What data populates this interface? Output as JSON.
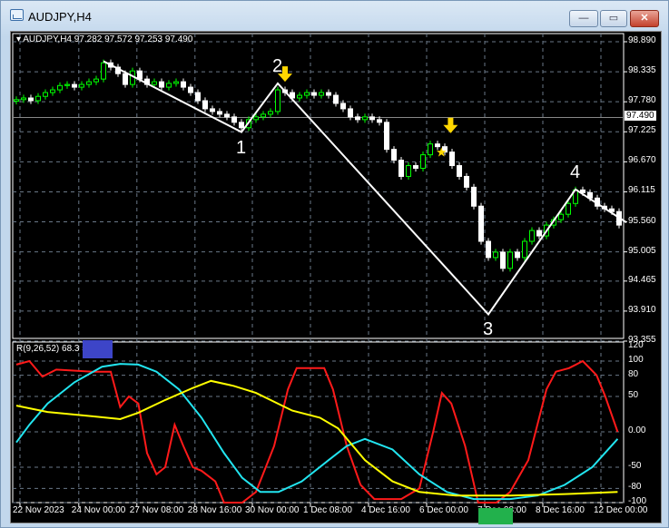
{
  "window": {
    "title": "AUDJPY,H4",
    "min": "—",
    "max": "▭",
    "close": "✕"
  },
  "chart_header": "AUDJPY,H4  97.282 97.572 97.253 97.490",
  "indicator_header": "R(9,26,52) 68.3 5",
  "current_price": "97.490",
  "colors": {
    "bull": "#00ff00",
    "bear": "#ffffff",
    "zigzag": "#ffffff",
    "red": "#ff1a1a",
    "cyan": "#22e5f0",
    "yellow": "#ffff00",
    "arrow": "#ffd700"
  },
  "chart_data": [
    {
      "type": "candlestick",
      "title": "AUDJPY,H4",
      "ylim": [
        93.355,
        98.89
      ],
      "price_ticks": [
        "98.890",
        "98.335",
        "97.780",
        "97.225",
        "96.670",
        "96.115",
        "95.560",
        "95.005",
        "94.465",
        "93.910",
        "93.355"
      ],
      "time_ticks": [
        {
          "t": -0.5,
          "label": "22 Nov 2023"
        },
        {
          "t": 7.6,
          "label": "24 Nov 00:00"
        },
        {
          "t": 15.6,
          "label": "27 Nov 08:00"
        },
        {
          "t": 23.6,
          "label": "28 Nov 16:00"
        },
        {
          "t": 31.5,
          "label": "30 Nov 00:00"
        },
        {
          "t": 39.5,
          "label": "1 Dec 08:00"
        },
        {
          "t": 47.5,
          "label": "4 Dec 16:00"
        },
        {
          "t": 55.5,
          "label": "6 Dec 00:00"
        },
        {
          "t": 63.5,
          "label": "7 Dec 08:00"
        },
        {
          "t": 71.5,
          "label": "8 Dec 16:00"
        },
        {
          "t": 79.5,
          "label": "12 Dec 00:00"
        }
      ],
      "closes": [
        97.82,
        97.85,
        97.8,
        97.88,
        97.95,
        98.0,
        98.08,
        98.1,
        98.05,
        98.1,
        98.15,
        98.2,
        98.5,
        98.42,
        98.3,
        98.1,
        98.35,
        98.2,
        98.1,
        98.15,
        98.05,
        98.12,
        98.15,
        98.05,
        97.95,
        97.8,
        97.65,
        97.6,
        97.55,
        97.5,
        97.4,
        97.3,
        97.45,
        97.5,
        97.55,
        97.6,
        98.0,
        97.95,
        97.85,
        97.9,
        97.95,
        97.9,
        97.95,
        97.9,
        97.75,
        97.65,
        97.5,
        97.45,
        97.5,
        97.45,
        97.4,
        96.9,
        96.7,
        96.4,
        96.6,
        96.55,
        96.8,
        97.0,
        96.95,
        96.85,
        96.6,
        96.4,
        96.2,
        95.85,
        95.2,
        94.9,
        95.0,
        94.7,
        95.0,
        94.9,
        95.2,
        95.4,
        95.3,
        95.5,
        95.6,
        95.7,
        95.9,
        96.15,
        96.1,
        96.0,
        95.85,
        95.8,
        95.75,
        95.5
      ],
      "zigzag": [
        {
          "t": 12,
          "p": 98.53,
          "label": ""
        },
        {
          "t": 31,
          "p": 97.22,
          "label": "1"
        },
        {
          "t": 36,
          "p": 98.12,
          "label": "2"
        },
        {
          "t": 65,
          "p": 93.85,
          "label": "3"
        },
        {
          "t": 77,
          "p": 96.16,
          "label": "4"
        },
        {
          "t": 84,
          "p": 95.55,
          "label": ""
        }
      ],
      "arrows": [
        {
          "t": 37,
          "p": 98.2
        },
        {
          "t": 59.8,
          "p": 97.25
        }
      ],
      "stars": [
        {
          "t": 58.5,
          "p": 96.85
        }
      ]
    },
    {
      "type": "line",
      "title": "R(9,26,52)",
      "ylim": [
        -110,
        125
      ],
      "ticks": [
        "120",
        "100",
        "80",
        "50",
        "0.00",
        "-50",
        "-80",
        "-100"
      ],
      "tick_values": [
        120,
        100,
        80,
        50,
        0,
        -50,
        -80,
        -100
      ],
      "series": [
        {
          "name": "red",
          "points": [
            [
              0,
              95
            ],
            [
              1.8,
              100
            ],
            [
              3.6,
              78
            ],
            [
              5.5,
              88
            ],
            [
              10.5,
              85
            ],
            [
              13,
              85
            ],
            [
              14.3,
              35
            ],
            [
              15.5,
              50
            ],
            [
              16.8,
              40
            ],
            [
              18,
              -30
            ],
            [
              19.3,
              -60
            ],
            [
              20.5,
              -50
            ],
            [
              21.8,
              10
            ],
            [
              23,
              -20
            ],
            [
              24.3,
              -50
            ],
            [
              25.5,
              -55
            ],
            [
              27.4,
              -70
            ],
            [
              28.6,
              -100
            ],
            [
              31.1,
              -100
            ],
            [
              33,
              -85
            ],
            [
              35.5,
              -20
            ],
            [
              37.4,
              60
            ],
            [
              38.6,
              90
            ],
            [
              42.4,
              90
            ],
            [
              43.6,
              60
            ],
            [
              45.5,
              -20
            ],
            [
              47.4,
              -75
            ],
            [
              49.3,
              -95
            ],
            [
              53,
              -95
            ],
            [
              55.5,
              -80
            ],
            [
              57.4,
              0
            ],
            [
              58.6,
              55
            ],
            [
              59.9,
              40
            ],
            [
              61.8,
              -20
            ],
            [
              63.6,
              -100
            ],
            [
              66.1,
              -100
            ],
            [
              68,
              -85
            ],
            [
              70.5,
              -40
            ],
            [
              73,
              60
            ],
            [
              74.3,
              85
            ],
            [
              76.1,
              90
            ],
            [
              78,
              100
            ],
            [
              79.9,
              80
            ],
            [
              81.1,
              50
            ],
            [
              82.8,
              0
            ]
          ]
        },
        {
          "name": "cyan",
          "points": [
            [
              0,
              -15
            ],
            [
              1.8,
              10
            ],
            [
              4.3,
              40
            ],
            [
              8,
              70
            ],
            [
              11.8,
              92
            ],
            [
              14.3,
              96
            ],
            [
              16.8,
              95
            ],
            [
              19.3,
              85
            ],
            [
              22.4,
              60
            ],
            [
              25.5,
              20
            ],
            [
              28.6,
              -30
            ],
            [
              31.1,
              -65
            ],
            [
              33.6,
              -85
            ],
            [
              36.1,
              -85
            ],
            [
              39.3,
              -70
            ],
            [
              43,
              -40
            ],
            [
              45.5,
              -20
            ],
            [
              48,
              -10
            ],
            [
              51.8,
              -25
            ],
            [
              55.5,
              -60
            ],
            [
              59.3,
              -85
            ],
            [
              63,
              -95
            ],
            [
              68,
              -95
            ],
            [
              71.8,
              -90
            ],
            [
              75.5,
              -75
            ],
            [
              79.3,
              -50
            ],
            [
              82.8,
              -10
            ]
          ]
        },
        {
          "name": "yellow",
          "points": [
            [
              0,
              37
            ],
            [
              4.3,
              28
            ],
            [
              10.5,
              22
            ],
            [
              14.3,
              18
            ],
            [
              16.8,
              27
            ],
            [
              20.5,
              45
            ],
            [
              24.3,
              62
            ],
            [
              26.8,
              72
            ],
            [
              29.9,
              65
            ],
            [
              33,
              55
            ],
            [
              38,
              30
            ],
            [
              41.8,
              20
            ],
            [
              44.3,
              5
            ],
            [
              48,
              -40
            ],
            [
              51.8,
              -70
            ],
            [
              55.5,
              -85
            ],
            [
              60.5,
              -90
            ],
            [
              68,
              -90
            ],
            [
              75.5,
              -88
            ],
            [
              82.8,
              -85
            ]
          ]
        }
      ]
    }
  ]
}
